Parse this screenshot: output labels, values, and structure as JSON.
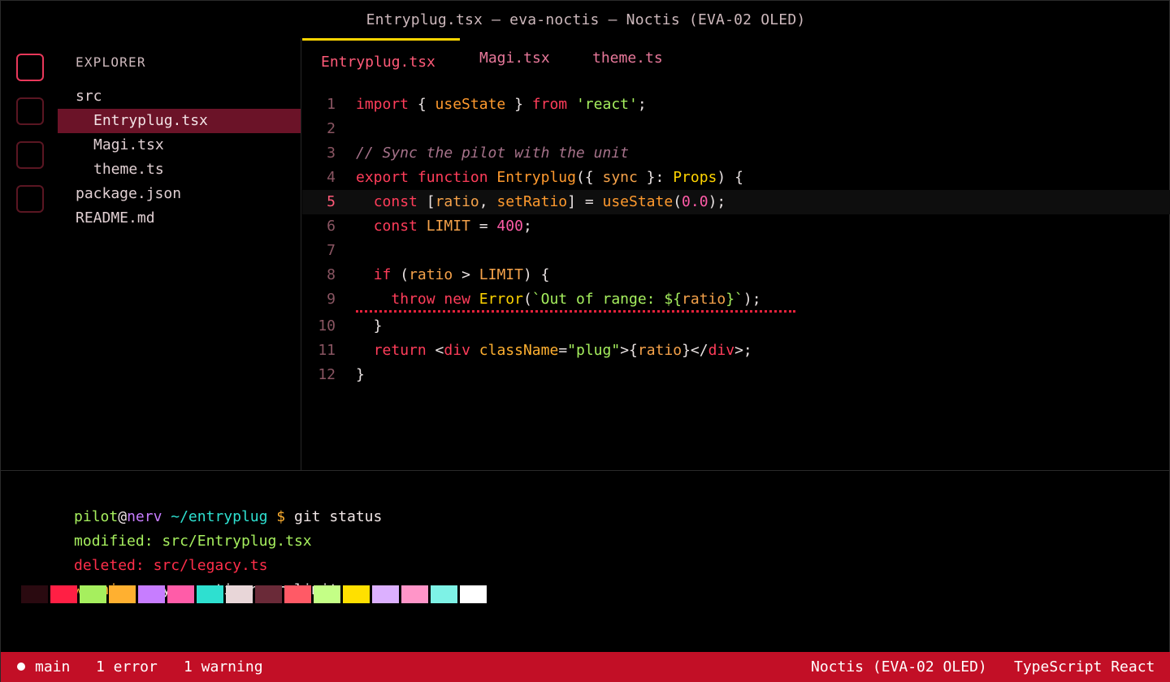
{
  "window": {
    "title": "Entryplug.tsx — eva-noctis — Noctis (EVA-02 OLED)"
  },
  "activity_bar": {
    "items": [
      "explorer-icon",
      "search-icon",
      "source-control-icon",
      "extensions-icon"
    ]
  },
  "sidebar": {
    "title": "EXPLORER",
    "tree": [
      {
        "label": "src",
        "level": 0
      },
      {
        "label": "Entryplug.tsx",
        "level": 1,
        "selected": true
      },
      {
        "label": "Magi.tsx",
        "level": 1
      },
      {
        "label": "theme.ts",
        "level": 1
      },
      {
        "label": "package.json",
        "level": 0
      },
      {
        "label": "README.md",
        "level": 0
      }
    ]
  },
  "editor": {
    "tabs": [
      {
        "label": "Entryplug.tsx",
        "active": true
      },
      {
        "label": "Magi.tsx",
        "active": false
      },
      {
        "label": "theme.ts",
        "active": false
      }
    ],
    "current_line": 5,
    "error_line": 9,
    "lines": [
      {
        "num": "1",
        "tokens": [
          [
            "k",
            "import"
          ],
          [
            "p",
            " { "
          ],
          [
            "f",
            "useState"
          ],
          [
            "p",
            " } "
          ],
          [
            "k",
            "from"
          ],
          [
            "p",
            " "
          ],
          [
            "s",
            "'react'"
          ],
          [
            "p",
            ";"
          ]
        ]
      },
      {
        "num": "2",
        "tokens": []
      },
      {
        "num": "3",
        "tokens": [
          [
            "c",
            "// Sync the pilot with the unit"
          ]
        ]
      },
      {
        "num": "4",
        "tokens": [
          [
            "k",
            "export"
          ],
          [
            "p",
            " "
          ],
          [
            "k",
            "function"
          ],
          [
            "p",
            " "
          ],
          [
            "f",
            "Entryplug"
          ],
          [
            "p",
            "({ "
          ],
          [
            "v",
            "sync"
          ],
          [
            "p",
            " }: "
          ],
          [
            "t",
            "Props"
          ],
          [
            "p",
            ") {"
          ]
        ]
      },
      {
        "num": "5",
        "tokens": [
          [
            "p",
            "  "
          ],
          [
            "k",
            "const"
          ],
          [
            "p",
            " ["
          ],
          [
            "v",
            "ratio"
          ],
          [
            "p",
            ", "
          ],
          [
            "f",
            "setRatio"
          ],
          [
            "p",
            "] = "
          ],
          [
            "f",
            "useState"
          ],
          [
            "p",
            "("
          ],
          [
            "n",
            "0.0"
          ],
          [
            "p",
            ");"
          ]
        ]
      },
      {
        "num": "6",
        "tokens": [
          [
            "p",
            "  "
          ],
          [
            "k",
            "const"
          ],
          [
            "p",
            " "
          ],
          [
            "v",
            "LIMIT"
          ],
          [
            "p",
            " = "
          ],
          [
            "n",
            "400"
          ],
          [
            "p",
            ";"
          ]
        ]
      },
      {
        "num": "7",
        "tokens": []
      },
      {
        "num": "8",
        "tokens": [
          [
            "p",
            "  "
          ],
          [
            "k",
            "if"
          ],
          [
            "p",
            " ("
          ],
          [
            "v",
            "ratio"
          ],
          [
            "p",
            " > "
          ],
          [
            "v",
            "LIMIT"
          ],
          [
            "p",
            ") {"
          ]
        ]
      },
      {
        "num": "9",
        "tokens": [
          [
            "p",
            "    "
          ],
          [
            "k",
            "throw"
          ],
          [
            "p",
            " "
          ],
          [
            "k",
            "new"
          ],
          [
            "p",
            " "
          ],
          [
            "t",
            "Error"
          ],
          [
            "p",
            "("
          ],
          [
            "s",
            "`Out of range: ${"
          ],
          [
            "v",
            "ratio"
          ],
          [
            "s",
            "}`"
          ],
          [
            "p",
            ");"
          ]
        ]
      },
      {
        "num": "10",
        "tokens": [
          [
            "p",
            "  }"
          ]
        ]
      },
      {
        "num": "11",
        "tokens": [
          [
            "p",
            "  "
          ],
          [
            "k",
            "return"
          ],
          [
            "p",
            " <"
          ],
          [
            "tag",
            "div"
          ],
          [
            "p",
            " "
          ],
          [
            "attr",
            "className"
          ],
          [
            "p",
            "="
          ],
          [
            "s",
            "\"plug\""
          ],
          [
            "p",
            ">{"
          ],
          [
            "v",
            "ratio"
          ],
          [
            "p",
            "}</"
          ],
          [
            "tag",
            "div"
          ],
          [
            "p",
            ">;"
          ]
        ]
      },
      {
        "num": "12",
        "tokens": [
          [
            "p",
            "}"
          ]
        ]
      }
    ]
  },
  "terminal": {
    "prompt": {
      "user": "pilot",
      "at": "@",
      "host": "nerv",
      "path": " ~/entryplug",
      "symbol": " $ ",
      "command": "git status"
    },
    "lines": [
      {
        "label": "modified:",
        "text": " src/Entryplug.tsx",
        "label_color": "#a6ef5e",
        "text_color": "#a6ef5e"
      },
      {
        "label": "deleted:",
        "text": " src/legacy.ts",
        "label_color": "#ff2e4a",
        "text_color": "#ff2e4a"
      },
      {
        "label": "warning:",
        "text": " sync ratio near limit",
        "label_color": "#ffb030",
        "text_color": "#f0e6e6"
      }
    ],
    "palette": [
      "#2a0a10",
      "#ff1f44",
      "#a6ef5e",
      "#ffb030",
      "#c77dff",
      "#ff5ca8",
      "#2ee0d0",
      "#e8d6d8",
      "#6a2a38",
      "#ff5a66",
      "#c4ff86",
      "#ffe000",
      "#dcb0ff",
      "#ff95c8",
      "#7ef2e6",
      "#ffffff"
    ]
  },
  "statusbar": {
    "branch": "main",
    "errors": "1 error",
    "warnings": "1 warning",
    "theme": "Noctis (EVA-02 OLED)",
    "language": "TypeScript React"
  },
  "colors": {
    "accent": "#ff3d5a",
    "selection": "#6b1328",
    "statusbar": "#c20f26",
    "tab_indicator": "#ffd600"
  }
}
